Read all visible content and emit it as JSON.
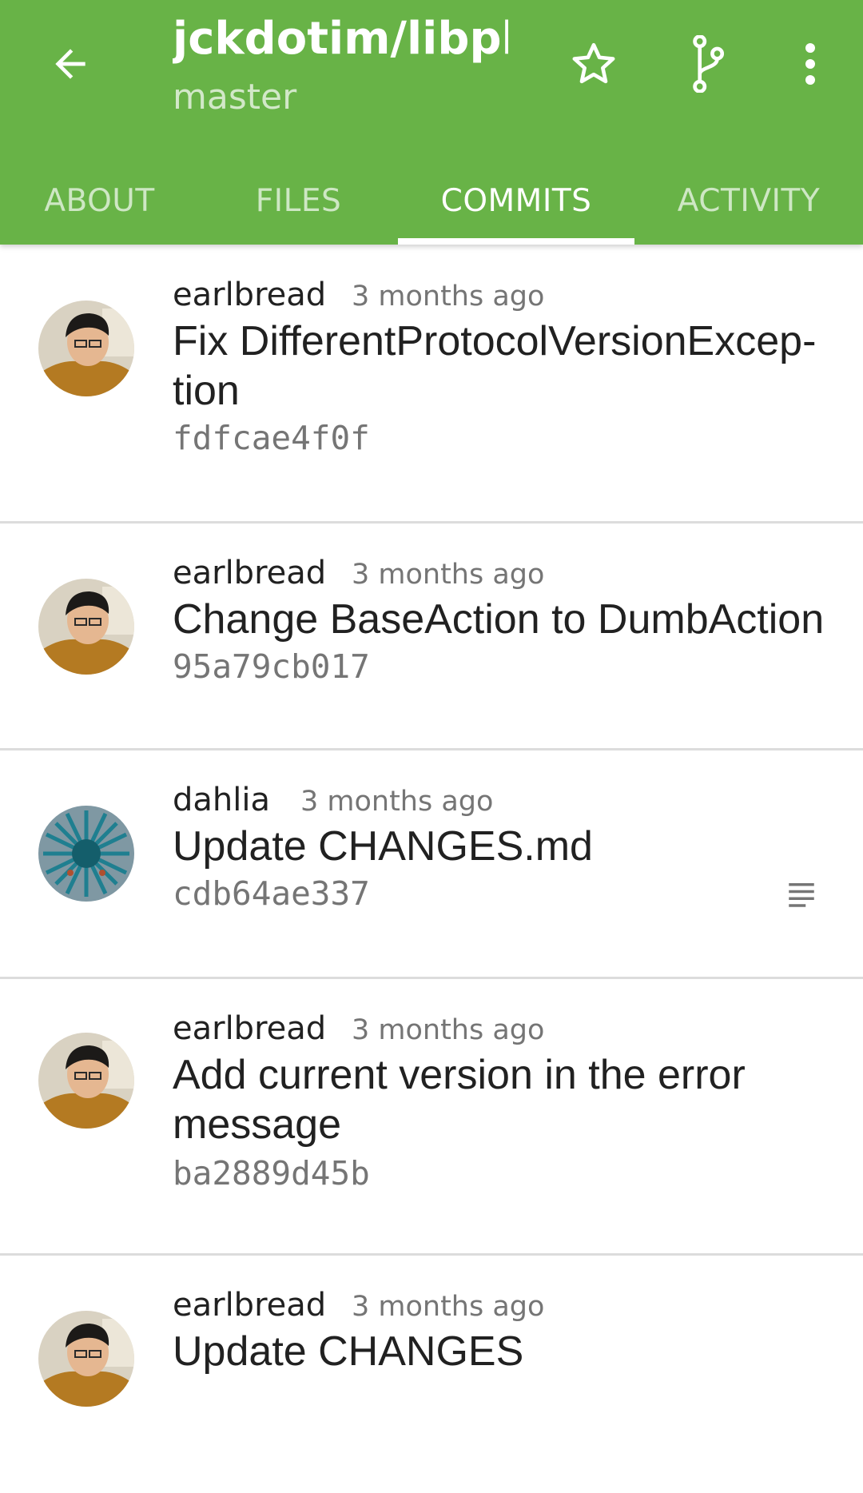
{
  "toolbar": {
    "title": "jckdotim/libpl…",
    "subtitle": "master",
    "back_icon": "arrow-back-icon",
    "star_icon": "star-outline-icon",
    "branch_icon": "branch-icon",
    "more_icon": "more-vert-icon"
  },
  "tabs": [
    {
      "label": "ABOUT"
    },
    {
      "label": "FILES"
    },
    {
      "label": "COMMITS",
      "active": true
    },
    {
      "label": "ACTIVITY"
    }
  ],
  "commits": [
    {
      "author": "earlbread",
      "time": "3 months ago",
      "message_line1": "Fix DifferentProtocolVersionExcep-",
      "message_line2": "tion",
      "sha": "fdfcae4f0f"
    },
    {
      "author": "earlbread",
      "time": "3 months ago",
      "message_line1": "Change BaseAction to DumbAction",
      "sha": "95a79cb017"
    },
    {
      "author": "dahlia",
      "time": "3 months ago",
      "message_line1": "Update CHANGES.md",
      "sha": "cdb64ae337",
      "has_description": true,
      "description_icon": "notes-icon"
    },
    {
      "author": "earlbread",
      "time": "3 months ago",
      "message_line1": "Add current version in the error",
      "message_line2": "message",
      "sha": "ba2889d45b"
    },
    {
      "author": "earlbread",
      "time": "3 months ago",
      "message_line1": "Update CHANGES"
    }
  ],
  "colors": {
    "appbar": "#68b347",
    "text_primary": "#212121",
    "text_secondary": "#757575"
  }
}
